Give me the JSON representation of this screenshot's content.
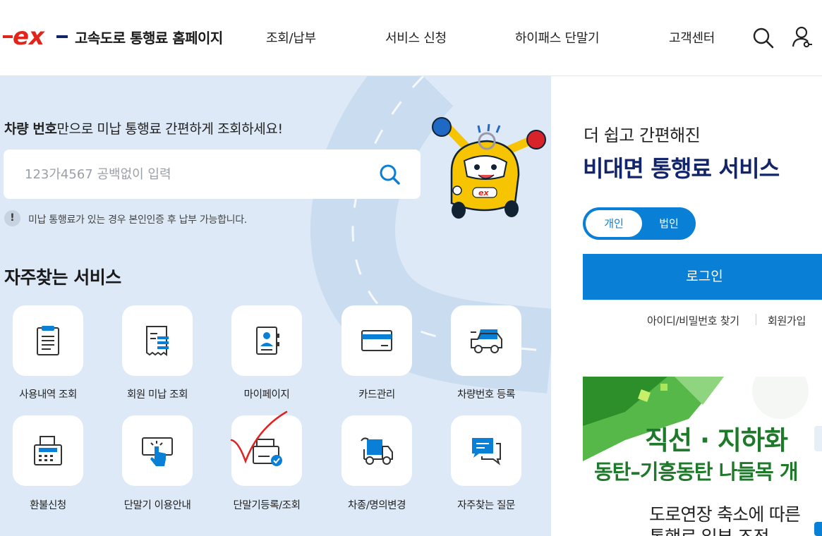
{
  "header": {
    "logo_text": "ex",
    "brand": "고속도로 통행료 홈페이지",
    "nav": [
      "조회/납부",
      "서비스 신청",
      "하이패스 단말기",
      "고객센터"
    ]
  },
  "lookup": {
    "title_bold": "차량 번호",
    "title_rest": "만으로 미납 통행료 간편하게 조회하세요!",
    "placeholder": "123가4567 공백없이 입력",
    "notice_mark": "!",
    "notice": "미납 통행료가 있는 경우 본인인증 후 납부 가능합니다."
  },
  "mascot": {
    "badge_text": "ex"
  },
  "favorites": {
    "title": "자주찾는 서비스",
    "items": [
      {
        "label": "사용내역 조회",
        "icon": "clipboard-list-icon"
      },
      {
        "label": "회원 미납 조회",
        "icon": "receipt-icon"
      },
      {
        "label": "마이페이지",
        "icon": "profile-book-icon"
      },
      {
        "label": "카드관리",
        "icon": "credit-card-icon"
      },
      {
        "label": "차량번호 등록",
        "icon": "car-icon"
      },
      {
        "label": "환불신청",
        "icon": "fax-printer-icon"
      },
      {
        "label": "단말기 이용안내",
        "icon": "touch-panel-icon"
      },
      {
        "label": "단말기등록/조회",
        "icon": "device-check-icon"
      },
      {
        "label": "차종/명의변경",
        "icon": "truck-swap-icon"
      },
      {
        "label": "자주찾는 질문",
        "icon": "chat-icon"
      }
    ]
  },
  "right": {
    "subtitle": "더 쉽고 간편해진",
    "title": "비대면 통행료 서비스",
    "toggle": {
      "personal": "개인",
      "business": "법인"
    },
    "login": "로그인",
    "find": "아이디/비밀번호 찾기",
    "join": "회원가입"
  },
  "banner": {
    "line1": "직선 · 지하화",
    "line2": "동탄–기흥동탄 나들목 개",
    "line3": "도로연장 축소에 따른",
    "line4": "통행료 일부 조정"
  },
  "colors": {
    "accent": "#0a7fd6",
    "navy": "#12246a",
    "panel_bg": "#dde9f6",
    "brand_red": "#e1251b",
    "banner_green": "#1e7a2a"
  }
}
